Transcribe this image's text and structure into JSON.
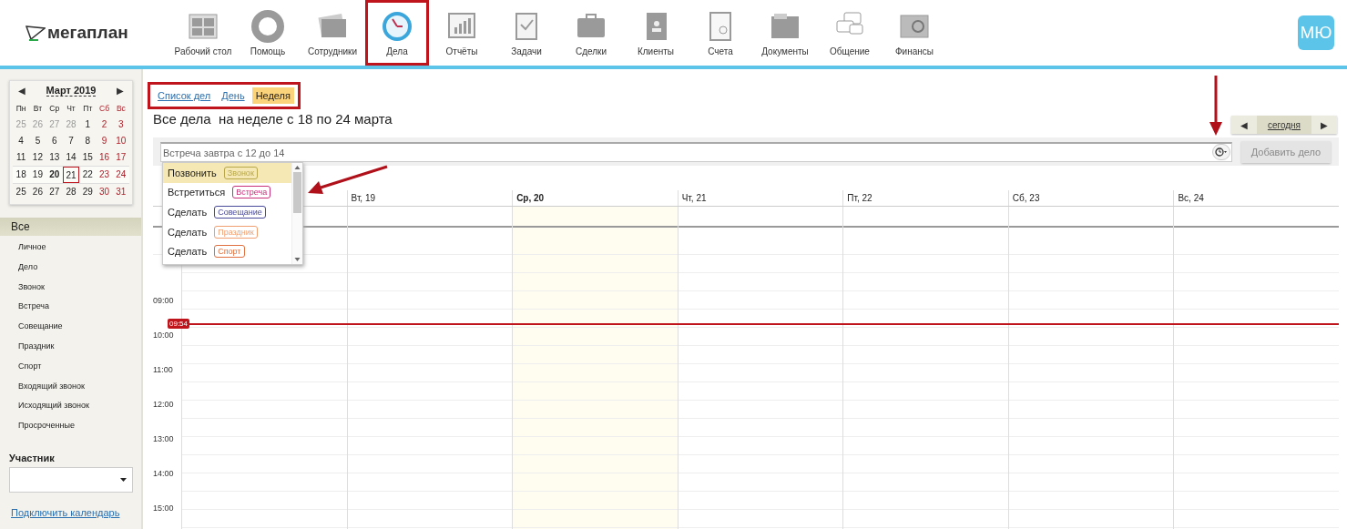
{
  "logo": {
    "text": "мегаплан"
  },
  "nav": [
    {
      "label": "Рабочий стол",
      "selected": false
    },
    {
      "label": "Помощь",
      "selected": false
    },
    {
      "label": "Сотрудники",
      "selected": false
    },
    {
      "label": "Дела",
      "selected": true
    },
    {
      "label": "Отчёты",
      "selected": false
    },
    {
      "label": "Задачи",
      "selected": false
    },
    {
      "label": "Сделки",
      "selected": false
    },
    {
      "label": "Клиенты",
      "selected": false
    },
    {
      "label": "Счета",
      "selected": false
    },
    {
      "label": "Документы",
      "selected": false
    },
    {
      "label": "Общение",
      "selected": false
    },
    {
      "label": "Финансы",
      "selected": false
    }
  ],
  "avatar": {
    "initials": "МЮ"
  },
  "mini_calendar": {
    "prev": "◀",
    "title": "Март 2019",
    "next": "▶",
    "weekdays": [
      {
        "label": "Пн",
        "weekend": false
      },
      {
        "label": "Вт",
        "weekend": false
      },
      {
        "label": "Ср",
        "weekend": false
      },
      {
        "label": "Чт",
        "weekend": false
      },
      {
        "label": "Пт",
        "weekend": false
      },
      {
        "label": "Сб",
        "weekend": true
      },
      {
        "label": "Вс",
        "weekend": true
      }
    ],
    "weeks": [
      [
        {
          "day": "25",
          "muted": true,
          "weekend": false,
          "today": false,
          "selected": false
        },
        {
          "day": "26",
          "muted": true,
          "weekend": false,
          "today": false,
          "selected": false
        },
        {
          "day": "27",
          "muted": true,
          "weekend": false,
          "today": false,
          "selected": false
        },
        {
          "day": "28",
          "muted": true,
          "weekend": false,
          "today": false,
          "selected": false
        },
        {
          "day": "1",
          "muted": false,
          "weekend": false,
          "today": false,
          "selected": false
        },
        {
          "day": "2",
          "muted": false,
          "weekend": true,
          "today": false,
          "selected": false
        },
        {
          "day": "3",
          "muted": false,
          "weekend": true,
          "today": false,
          "selected": false
        }
      ],
      [
        {
          "day": "4",
          "muted": false,
          "weekend": false,
          "today": false,
          "selected": false
        },
        {
          "day": "5",
          "muted": false,
          "weekend": false,
          "today": false,
          "selected": false
        },
        {
          "day": "6",
          "muted": false,
          "weekend": false,
          "today": false,
          "selected": false
        },
        {
          "day": "7",
          "muted": false,
          "weekend": false,
          "today": false,
          "selected": false
        },
        {
          "day": "8",
          "muted": false,
          "weekend": false,
          "today": false,
          "selected": false
        },
        {
          "day": "9",
          "muted": false,
          "weekend": true,
          "today": false,
          "selected": false
        },
        {
          "day": "10",
          "muted": false,
          "weekend": true,
          "today": false,
          "selected": false
        }
      ],
      [
        {
          "day": "11",
          "muted": false,
          "weekend": false,
          "today": false,
          "selected": false
        },
        {
          "day": "12",
          "muted": false,
          "weekend": false,
          "today": false,
          "selected": false
        },
        {
          "day": "13",
          "muted": false,
          "weekend": false,
          "today": false,
          "selected": false
        },
        {
          "day": "14",
          "muted": false,
          "weekend": false,
          "today": false,
          "selected": false
        },
        {
          "day": "15",
          "muted": false,
          "weekend": false,
          "today": false,
          "selected": false
        },
        {
          "day": "16",
          "muted": false,
          "weekend": true,
          "today": false,
          "selected": false
        },
        {
          "day": "17",
          "muted": false,
          "weekend": true,
          "today": false,
          "selected": false
        }
      ],
      [
        {
          "day": "18",
          "muted": false,
          "weekend": false,
          "today": false,
          "selected": false
        },
        {
          "day": "19",
          "muted": false,
          "weekend": false,
          "today": false,
          "selected": false
        },
        {
          "day": "20",
          "muted": false,
          "weekend": false,
          "today": true,
          "selected": false
        },
        {
          "day": "21",
          "muted": false,
          "weekend": false,
          "today": false,
          "selected": true
        },
        {
          "day": "22",
          "muted": false,
          "weekend": false,
          "today": false,
          "selected": false
        },
        {
          "day": "23",
          "muted": false,
          "weekend": true,
          "today": false,
          "selected": false
        },
        {
          "day": "24",
          "muted": false,
          "weekend": true,
          "today": false,
          "selected": false
        }
      ],
      [
        {
          "day": "25",
          "muted": false,
          "weekend": false,
          "today": false,
          "selected": false
        },
        {
          "day": "26",
          "muted": false,
          "weekend": false,
          "today": false,
          "selected": false
        },
        {
          "day": "27",
          "muted": false,
          "weekend": false,
          "today": false,
          "selected": false
        },
        {
          "day": "28",
          "muted": false,
          "weekend": false,
          "today": false,
          "selected": false
        },
        {
          "day": "29",
          "muted": false,
          "weekend": false,
          "today": false,
          "selected": false
        },
        {
          "day": "30",
          "muted": false,
          "weekend": true,
          "today": false,
          "selected": false
        },
        {
          "day": "31",
          "muted": false,
          "weekend": true,
          "today": false,
          "selected": false
        }
      ]
    ]
  },
  "filters": [
    {
      "label": "Все",
      "selected": true
    },
    {
      "label": "Личное",
      "selected": false
    },
    {
      "label": "Дело",
      "selected": false
    },
    {
      "label": "Звонок",
      "selected": false
    },
    {
      "label": "Встреча",
      "selected": false
    },
    {
      "label": "Совещание",
      "selected": false
    },
    {
      "label": "Праздник",
      "selected": false
    },
    {
      "label": "Спорт",
      "selected": false
    },
    {
      "label": "Входящий звонок",
      "selected": false
    },
    {
      "label": "Исходящий звонок",
      "selected": false
    },
    {
      "label": "Просроченные",
      "selected": false
    }
  ],
  "participant": {
    "label": "Участник"
  },
  "connect_link": "Подключить календарь",
  "views": [
    {
      "label": "Список дел",
      "selected": false
    },
    {
      "label": "День",
      "selected": false
    },
    {
      "label": "Неделя",
      "selected": true
    }
  ],
  "title": "Все дела  на неделе с 18 по 24 марта",
  "period_nav": {
    "prev": "◀",
    "today": "сегодня",
    "next": "▶"
  },
  "quick_add": {
    "placeholder": "Встреча завтра с 12 до 14",
    "button": "Добавить дело",
    "button_disabled": true
  },
  "suggestions": [
    {
      "action": "Позвонить",
      "tag": "Звонок",
      "color": "#b8a84a",
      "selected": true
    },
    {
      "action": "Встретиться",
      "tag": "Встреча",
      "color": "#c8307a",
      "selected": false
    },
    {
      "action": "Сделать",
      "tag": "Совещание",
      "color": "#4a4a9a",
      "selected": false
    },
    {
      "action": "Сделать",
      "tag": "Праздник",
      "color": "#f0a070",
      "selected": false
    },
    {
      "action": "Сделать",
      "tag": "Спорт",
      "color": "#e07040",
      "selected": false
    }
  ],
  "week": {
    "days": [
      {
        "label": "Вт, 19",
        "today": false
      },
      {
        "label": "Ср, 20",
        "today": true
      },
      {
        "label": "Чт, 21",
        "today": false
      },
      {
        "label": "Пт, 22",
        "today": false
      },
      {
        "label": "Сб, 23",
        "today": false
      },
      {
        "label": "Вс, 24",
        "today": false
      }
    ],
    "hours": [
      "09:00",
      "10:00",
      "11:00",
      "12:00",
      "13:00",
      "14:00",
      "15:00"
    ],
    "now": "09:54"
  }
}
